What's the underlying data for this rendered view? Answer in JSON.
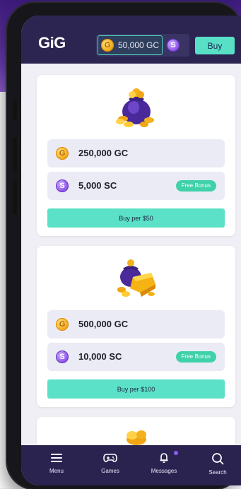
{
  "header": {
    "logo": "GiG",
    "gc_balance": "50,000 GC",
    "gc_coin_letter": "G",
    "sc_coin_letter": "S",
    "buy_label": "Buy"
  },
  "offers": [
    {
      "gc_amount": "250,000 GC",
      "sc_amount": "5,000 SC",
      "badge": "Free Bonus",
      "cta": "Buy per $50"
    },
    {
      "gc_amount": "500,000 GC",
      "sc_amount": "10,000 SC",
      "badge": "Free Bonus",
      "cta": "Buy per $100"
    }
  ],
  "nav": {
    "items": [
      {
        "label": "Menu",
        "icon": "menu-icon"
      },
      {
        "label": "Games",
        "icon": "gamepad-icon"
      },
      {
        "label": "Messages",
        "icon": "bell-icon"
      },
      {
        "label": "Search",
        "icon": "search-icon"
      }
    ]
  },
  "colors": {
    "header_bg": "#2c2552",
    "accent_teal": "#5be1c7",
    "badge_green": "#3fd1a9",
    "gold": "#f0a514",
    "purple": "#8a4fe6"
  }
}
